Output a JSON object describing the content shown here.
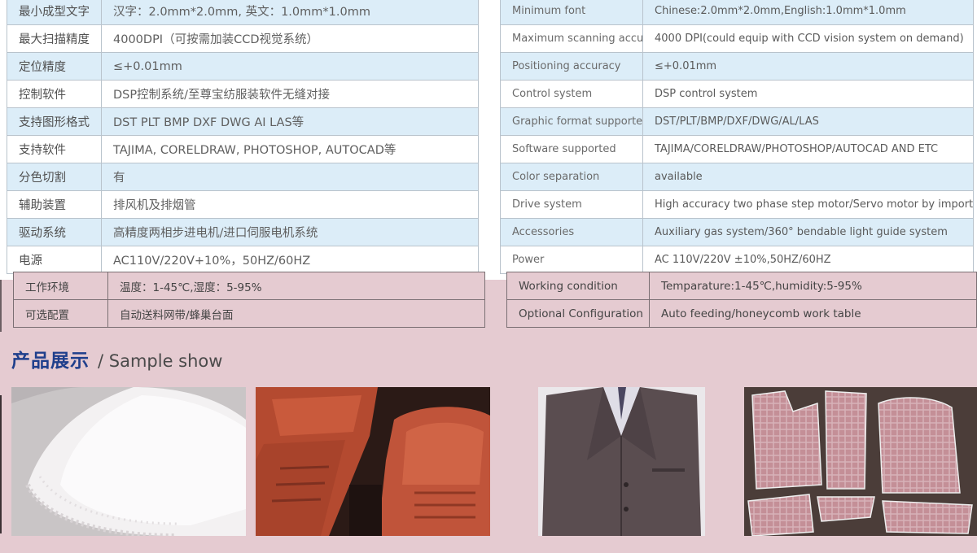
{
  "spec_cn": [
    {
      "k": "最小成型文字",
      "v": "汉字：2.0mm*2.0mm, 英文：1.0mm*1.0mm"
    },
    {
      "k": "最大扫描精度",
      "v": "4000DPI（可按需加装CCD视觉系统）"
    },
    {
      "k": "定位精度",
      "v": "≤+0.01mm"
    },
    {
      "k": "控制软件",
      "v": "DSP控制系统/至尊宝纺服装软件无缝对接"
    },
    {
      "k": "支持图形格式",
      "v": "DST PLT BMP DXF DWG AI LAS等"
    },
    {
      "k": "支持软件",
      "v": "TAJIMA, CORELDRAW, PHOTOSHOP, AUTOCAD等"
    },
    {
      "k": "分色切割",
      "v": "有"
    },
    {
      "k": "辅助装置",
      "v": "排风机及排烟管"
    },
    {
      "k": "驱动系统",
      "v": "高精度两相步进电机/进口伺服电机系统"
    },
    {
      "k": "电源",
      "v": "AC110V/220V+10%，50HZ/60HZ"
    },
    {
      "k": "工作环境",
      "v": "温度：1-45℃,湿度：5-95%"
    },
    {
      "k": "可选配置",
      "v": "自动送料网带/蜂巢台面"
    }
  ],
  "spec_en": [
    {
      "k": "Minimum font",
      "v": "Chinese:2.0mm*2.0mm,English:1.0mm*1.0mm"
    },
    {
      "k": "Maximum scanning accuracy",
      "v": "4000 DPI(could equip with CCD vision system on demand)"
    },
    {
      "k": "Positioning accuracy",
      "v": "≤+0.01mm"
    },
    {
      "k": "Control system",
      "v": "DSP control system"
    },
    {
      "k": "Graphic format supported",
      "v": "DST/PLT/BMP/DXF/DWG/AL/LAS"
    },
    {
      "k": "Software supported",
      "v": "TAJIMA/CORELDRAW/PHOTOSHOP/AUTOCAD AND ETC"
    },
    {
      "k": "Color separation",
      "v": "available"
    },
    {
      "k": "Drive system",
      "v": "High accuracy two phase step motor/Servo motor by imported"
    },
    {
      "k": "Accessories",
      "v": "Auxiliary gas system/360°  bendable light guide system"
    },
    {
      "k": "Power",
      "v": "AC 110V/220V ±10%,50HZ/60HZ"
    },
    {
      "k": "Working condition",
      "v": "Temparature:1-45℃,humidity:5-95%"
    },
    {
      "k": "Optional Configuration",
      "v": "Auto feeding/honeycomb work table"
    }
  ],
  "section": {
    "title_cn": "产品展示",
    "title_en": "/ Sample show"
  },
  "colors": {
    "title_blue": "#1f3f8c",
    "row_blue": "#dcedf8",
    "lower_bg": "#e5cbd1"
  },
  "photos": [
    {
      "name": "lace-fabric"
    },
    {
      "name": "car-seats"
    },
    {
      "name": "suit-jacket"
    },
    {
      "name": "cut-garment-patterns"
    }
  ]
}
